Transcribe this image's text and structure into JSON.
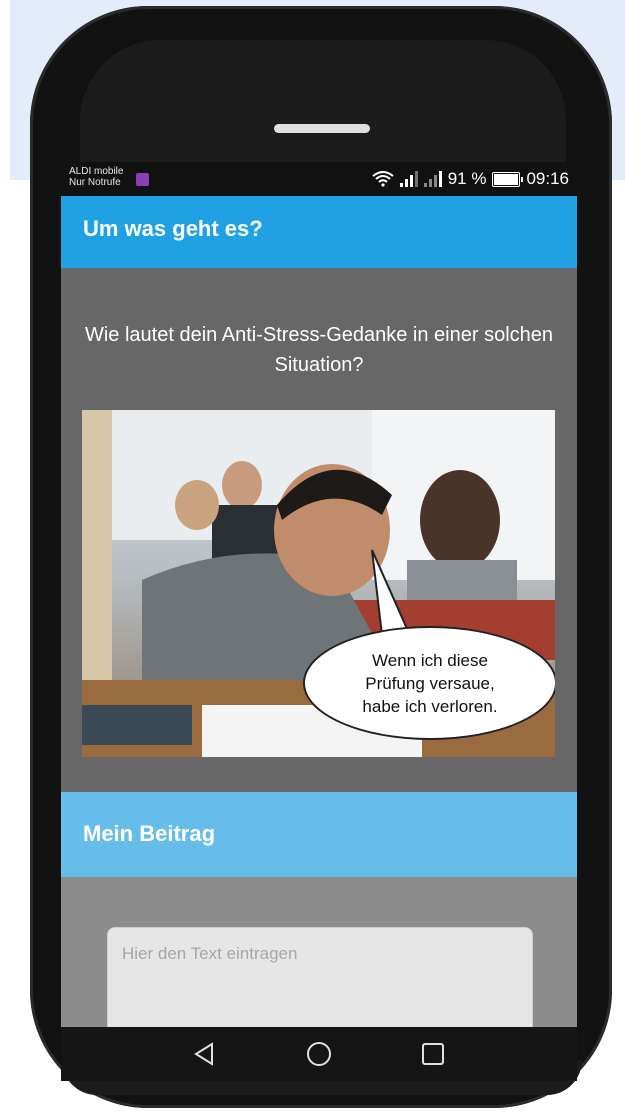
{
  "status_bar": {
    "carrier_line1": "ALDI mobile",
    "carrier_line2": "Nur Notrufe",
    "battery_percent": "91 %",
    "time": "09:16"
  },
  "header": {
    "title": "Um was geht es?"
  },
  "main": {
    "question": "Wie lautet dein Anti-Stress-Gedanke in einer solchen Situation?",
    "bubble_line1": "Wenn ich diese",
    "bubble_line2": "Prüfung versaue,",
    "bubble_line3": "habe ich verloren."
  },
  "contribution": {
    "title": "Mein Beitrag",
    "placeholder": "Hier den Text eintragen"
  },
  "colors": {
    "header": "#1fa1e3",
    "section": "#66bde9",
    "content_bg": "#676767"
  }
}
